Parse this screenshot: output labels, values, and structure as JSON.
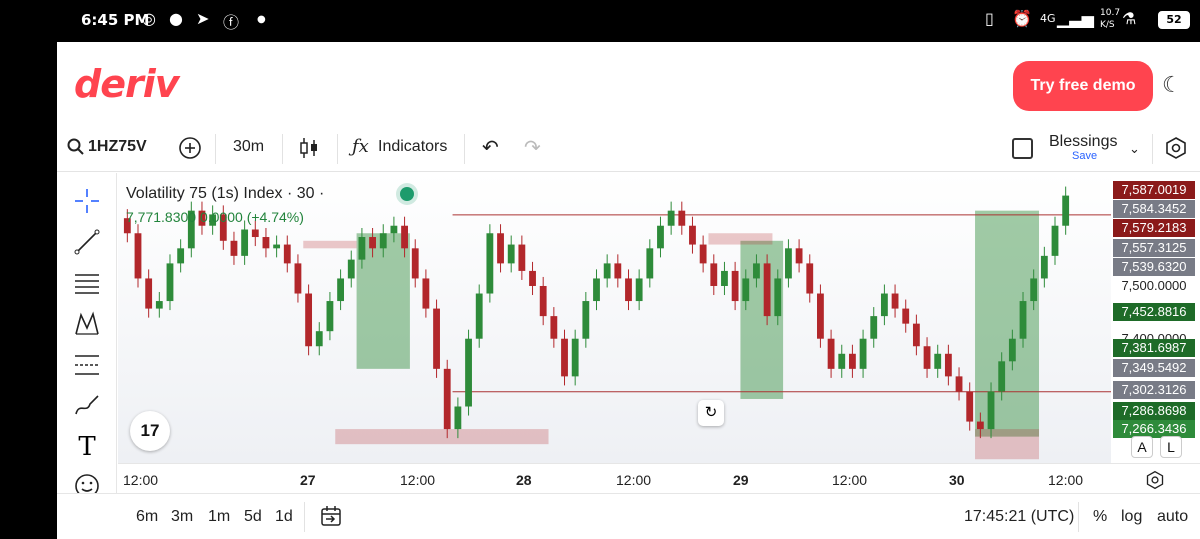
{
  "status_bar": {
    "time": "6:45 PM",
    "network": "4G",
    "speed_top": "10.7",
    "speed_bottom": "K/S",
    "battery": "52"
  },
  "app": {
    "logo": "deriv",
    "demo_button": "Try free demo"
  },
  "toolbar": {
    "symbol": "1HZ75V",
    "interval": "30m",
    "indicators": "Indicators",
    "account_name": "Blessings",
    "account_action": "Save"
  },
  "legend": {
    "title": "Volatility 75 (1s) Index · 30 ·",
    "price": "7,771.8300",
    "change": "0.0000",
    "change_pct": "(+4.74%)"
  },
  "price_axis": {
    "labels": [
      {
        "text": "7,587.0019",
        "color": "#8b1a1a"
      },
      {
        "text": "7,584.3452",
        "color": "#787b86"
      },
      {
        "text": "7,579.2183",
        "color": "#8b1a1a"
      },
      {
        "text": "7,557.3125",
        "color": "#787b86"
      },
      {
        "text": "7,539.6320",
        "color": "#787b86"
      },
      {
        "text": "7,500.0000",
        "color": ""
      },
      {
        "text": "7,452.8816",
        "color": "#1e6b28"
      },
      {
        "text": "7,400.0000",
        "color": ""
      },
      {
        "text": "7,381.6987",
        "color": "#1e6b28"
      },
      {
        "text": "7,349.5492",
        "color": "#787b86"
      },
      {
        "text": "7,302.3126",
        "color": "#787b86"
      },
      {
        "text": "7,286.8698",
        "color": "#1e6b28"
      },
      {
        "text": "7,266.3436",
        "color": "#2e8b3a"
      }
    ]
  },
  "time_axis": {
    "labels": [
      "12:00",
      "27",
      "12:00",
      "28",
      "12:00",
      "29",
      "12:00",
      "30",
      "12:00"
    ]
  },
  "bottom_bar": {
    "ranges": [
      "6m",
      "3m",
      "1m",
      "5d",
      "1d"
    ],
    "clock": "17:45:21 (UTC)",
    "percent": "%",
    "log": "log",
    "auto": "auto"
  },
  "chart_buttons": {
    "a": "A",
    "l": "L",
    "tv": "17"
  },
  "chart_data": {
    "type": "candlestick",
    "up_color": "#2e8b3a",
    "down_color": "#b2272b",
    "series": [
      {
        "o": 7580,
        "c": 7560
      },
      {
        "o": 7560,
        "c": 7500
      },
      {
        "o": 7500,
        "c": 7460
      },
      {
        "o": 7460,
        "c": 7470
      },
      {
        "o": 7470,
        "c": 7520
      },
      {
        "o": 7520,
        "c": 7540
      },
      {
        "o": 7540,
        "c": 7590
      },
      {
        "o": 7590,
        "c": 7570
      },
      {
        "o": 7570,
        "c": 7585
      },
      {
        "o": 7585,
        "c": 7550
      },
      {
        "o": 7550,
        "c": 7530
      },
      {
        "o": 7530,
        "c": 7565
      },
      {
        "o": 7565,
        "c": 7555
      },
      {
        "o": 7555,
        "c": 7540
      },
      {
        "o": 7540,
        "c": 7545
      },
      {
        "o": 7545,
        "c": 7520
      },
      {
        "o": 7520,
        "c": 7480
      },
      {
        "o": 7480,
        "c": 7410
      },
      {
        "o": 7410,
        "c": 7430
      },
      {
        "o": 7430,
        "c": 7470
      },
      {
        "o": 7470,
        "c": 7500
      },
      {
        "o": 7500,
        "c": 7525
      },
      {
        "o": 7525,
        "c": 7555
      },
      {
        "o": 7555,
        "c": 7540
      },
      {
        "o": 7540,
        "c": 7560
      },
      {
        "o": 7560,
        "c": 7570
      },
      {
        "o": 7570,
        "c": 7540
      },
      {
        "o": 7540,
        "c": 7500
      },
      {
        "o": 7500,
        "c": 7460
      },
      {
        "o": 7460,
        "c": 7380
      },
      {
        "o": 7380,
        "c": 7300
      },
      {
        "o": 7300,
        "c": 7330
      },
      {
        "o": 7330,
        "c": 7420
      },
      {
        "o": 7420,
        "c": 7480
      },
      {
        "o": 7480,
        "c": 7560
      },
      {
        "o": 7560,
        "c": 7520
      },
      {
        "o": 7520,
        "c": 7545
      },
      {
        "o": 7545,
        "c": 7510
      },
      {
        "o": 7510,
        "c": 7490
      },
      {
        "o": 7490,
        "c": 7450
      },
      {
        "o": 7450,
        "c": 7420
      },
      {
        "o": 7420,
        "c": 7370
      },
      {
        "o": 7370,
        "c": 7420
      },
      {
        "o": 7420,
        "c": 7470
      },
      {
        "o": 7470,
        "c": 7500
      },
      {
        "o": 7500,
        "c": 7520
      },
      {
        "o": 7520,
        "c": 7500
      },
      {
        "o": 7500,
        "c": 7470
      },
      {
        "o": 7470,
        "c": 7500
      },
      {
        "o": 7500,
        "c": 7540
      },
      {
        "o": 7540,
        "c": 7570
      },
      {
        "o": 7570,
        "c": 7590
      },
      {
        "o": 7590,
        "c": 7570
      },
      {
        "o": 7570,
        "c": 7545
      },
      {
        "o": 7545,
        "c": 7520
      },
      {
        "o": 7520,
        "c": 7490
      },
      {
        "o": 7490,
        "c": 7510
      },
      {
        "o": 7510,
        "c": 7470
      },
      {
        "o": 7470,
        "c": 7500
      },
      {
        "o": 7500,
        "c": 7520
      },
      {
        "o": 7520,
        "c": 7450
      },
      {
        "o": 7450,
        "c": 7500
      },
      {
        "o": 7500,
        "c": 7540
      },
      {
        "o": 7540,
        "c": 7520
      },
      {
        "o": 7520,
        "c": 7480
      },
      {
        "o": 7480,
        "c": 7420
      },
      {
        "o": 7420,
        "c": 7380
      },
      {
        "o": 7380,
        "c": 7400
      },
      {
        "o": 7400,
        "c": 7380
      },
      {
        "o": 7380,
        "c": 7420
      },
      {
        "o": 7420,
        "c": 7450
      },
      {
        "o": 7450,
        "c": 7480
      },
      {
        "o": 7480,
        "c": 7460
      },
      {
        "o": 7460,
        "c": 7440
      },
      {
        "o": 7440,
        "c": 7410
      },
      {
        "o": 7410,
        "c": 7380
      },
      {
        "o": 7380,
        "c": 7400
      },
      {
        "o": 7400,
        "c": 7370
      },
      {
        "o": 7370,
        "c": 7350
      },
      {
        "o": 7350,
        "c": 7310
      },
      {
        "o": 7310,
        "c": 7300
      },
      {
        "o": 7300,
        "c": 7350
      },
      {
        "o": 7350,
        "c": 7390
      },
      {
        "o": 7390,
        "c": 7420
      },
      {
        "o": 7420,
        "c": 7470
      },
      {
        "o": 7470,
        "c": 7500
      },
      {
        "o": 7500,
        "c": 7530
      },
      {
        "o": 7530,
        "c": 7570
      },
      {
        "o": 7570,
        "c": 7610
      }
    ],
    "zones": [
      {
        "from": 22,
        "to": 27,
        "top": 7560,
        "bottom": 7380,
        "kind": "long"
      },
      {
        "from": 58,
        "to": 62,
        "top": 7550,
        "bottom": 7340,
        "kind": "long"
      },
      {
        "from": 80,
        "to": 86,
        "top": 7590,
        "bottom": 7290,
        "kind": "long"
      },
      {
        "from": 17,
        "to": 22,
        "top": 7550,
        "bottom": 7540,
        "kind": "short"
      },
      {
        "from": 20,
        "to": 40,
        "top": 7300,
        "bottom": 7280,
        "kind": "short"
      },
      {
        "from": 55,
        "to": 61,
        "top": 7560,
        "bottom": 7545,
        "kind": "short"
      },
      {
        "from": 80,
        "to": 86,
        "top": 7300,
        "bottom": 7260,
        "kind": "short"
      }
    ],
    "h_lines": [
      {
        "price": 7584.3452,
        "from": 31,
        "to": 95
      },
      {
        "price": 7349.5492,
        "from": 31,
        "to": 95
      }
    ],
    "y_range": [
      7255,
      7640
    ]
  }
}
